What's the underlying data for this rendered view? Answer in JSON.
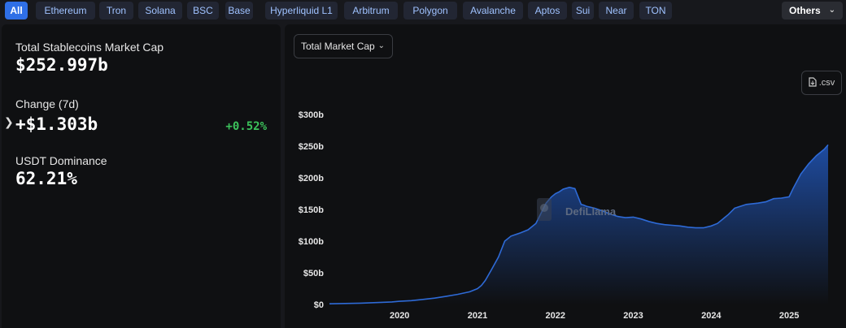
{
  "chains": {
    "items": [
      {
        "label": "All",
        "active": true
      },
      {
        "label": "Ethereum"
      },
      {
        "label": "Tron"
      },
      {
        "label": "Solana"
      },
      {
        "label": "BSC"
      },
      {
        "label": "Base"
      },
      {
        "label": "Hyperliquid L1"
      },
      {
        "label": "Arbitrum"
      },
      {
        "label": "Polygon"
      },
      {
        "label": "Avalanche"
      },
      {
        "label": "Aptos"
      },
      {
        "label": "Sui"
      },
      {
        "label": "Near"
      },
      {
        "label": "TON"
      }
    ],
    "others_label": "Others"
  },
  "stats": {
    "total_label": "Total Stablecoins Market Cap",
    "total_value": "$252.997b",
    "change_label": "Change (7d)",
    "change_value": "+$1.303b",
    "change_pct": "+0.52%",
    "dominance_label": "USDT Dominance",
    "dominance_value": "62.21%"
  },
  "chart_controls": {
    "metric_label": "Total Market Cap",
    "csv_label": ".csv"
  },
  "watermark": "DefiLlama",
  "colors": {
    "accent": "#2f6fe6",
    "line": "#2e6ad6",
    "positive": "#3cc25b"
  },
  "chart_data": {
    "type": "area",
    "title": "",
    "xlabel": "",
    "ylabel": "",
    "ylim": [
      0,
      300
    ],
    "y_ticks": [
      0,
      50,
      100,
      150,
      200,
      250,
      300
    ],
    "y_tick_labels": [
      "$0",
      "$50b",
      "$100b",
      "$150b",
      "$200b",
      "$250b",
      "$300b"
    ],
    "x_ticks": [
      2020,
      2021,
      2022,
      2023,
      2024,
      2025
    ],
    "x_tick_labels": [
      "2020",
      "2021",
      "2022",
      "2023",
      "2024",
      "2025"
    ],
    "xlim": [
      2019.1,
      2025.5
    ],
    "grid": false,
    "series": [
      {
        "values_unit": "USD billions",
        "x": [
          2019.1,
          2019.5,
          2019.9,
          2020.0,
          2020.15,
          2020.3,
          2020.45,
          2020.6,
          2020.75,
          2020.9,
          2021.0,
          2021.05,
          2021.1,
          2021.18,
          2021.27,
          2021.35,
          2021.43,
          2021.55,
          2021.65,
          2021.75,
          2021.82,
          2021.88,
          2021.95,
          2022.0,
          2022.05,
          2022.1,
          2022.18,
          2022.25,
          2022.33,
          2022.36,
          2022.4,
          2022.5,
          2022.6,
          2022.7,
          2022.8,
          2022.9,
          2023.0,
          2023.1,
          2023.2,
          2023.3,
          2023.4,
          2023.5,
          2023.6,
          2023.7,
          2023.8,
          2023.9,
          2024.0,
          2024.08,
          2024.15,
          2024.22,
          2024.3,
          2024.45,
          2024.6,
          2024.7,
          2024.8,
          2024.9,
          2025.0,
          2025.05,
          2025.15,
          2025.25,
          2025.35,
          2025.45,
          2025.5
        ],
        "values": [
          1,
          2,
          4,
          5,
          6,
          8,
          10,
          13,
          16,
          20,
          25,
          30,
          38,
          55,
          75,
          100,
          108,
          113,
          118,
          128,
          145,
          160,
          170,
          175,
          178,
          182,
          185,
          183,
          158,
          157,
          155,
          152,
          148,
          143,
          139,
          137,
          138,
          135,
          131,
          128,
          126,
          125,
          124,
          122,
          121,
          121,
          124,
          128,
          135,
          142,
          152,
          158,
          160,
          162,
          167,
          168,
          170,
          183,
          206,
          222,
          235,
          245,
          252
        ]
      }
    ]
  }
}
